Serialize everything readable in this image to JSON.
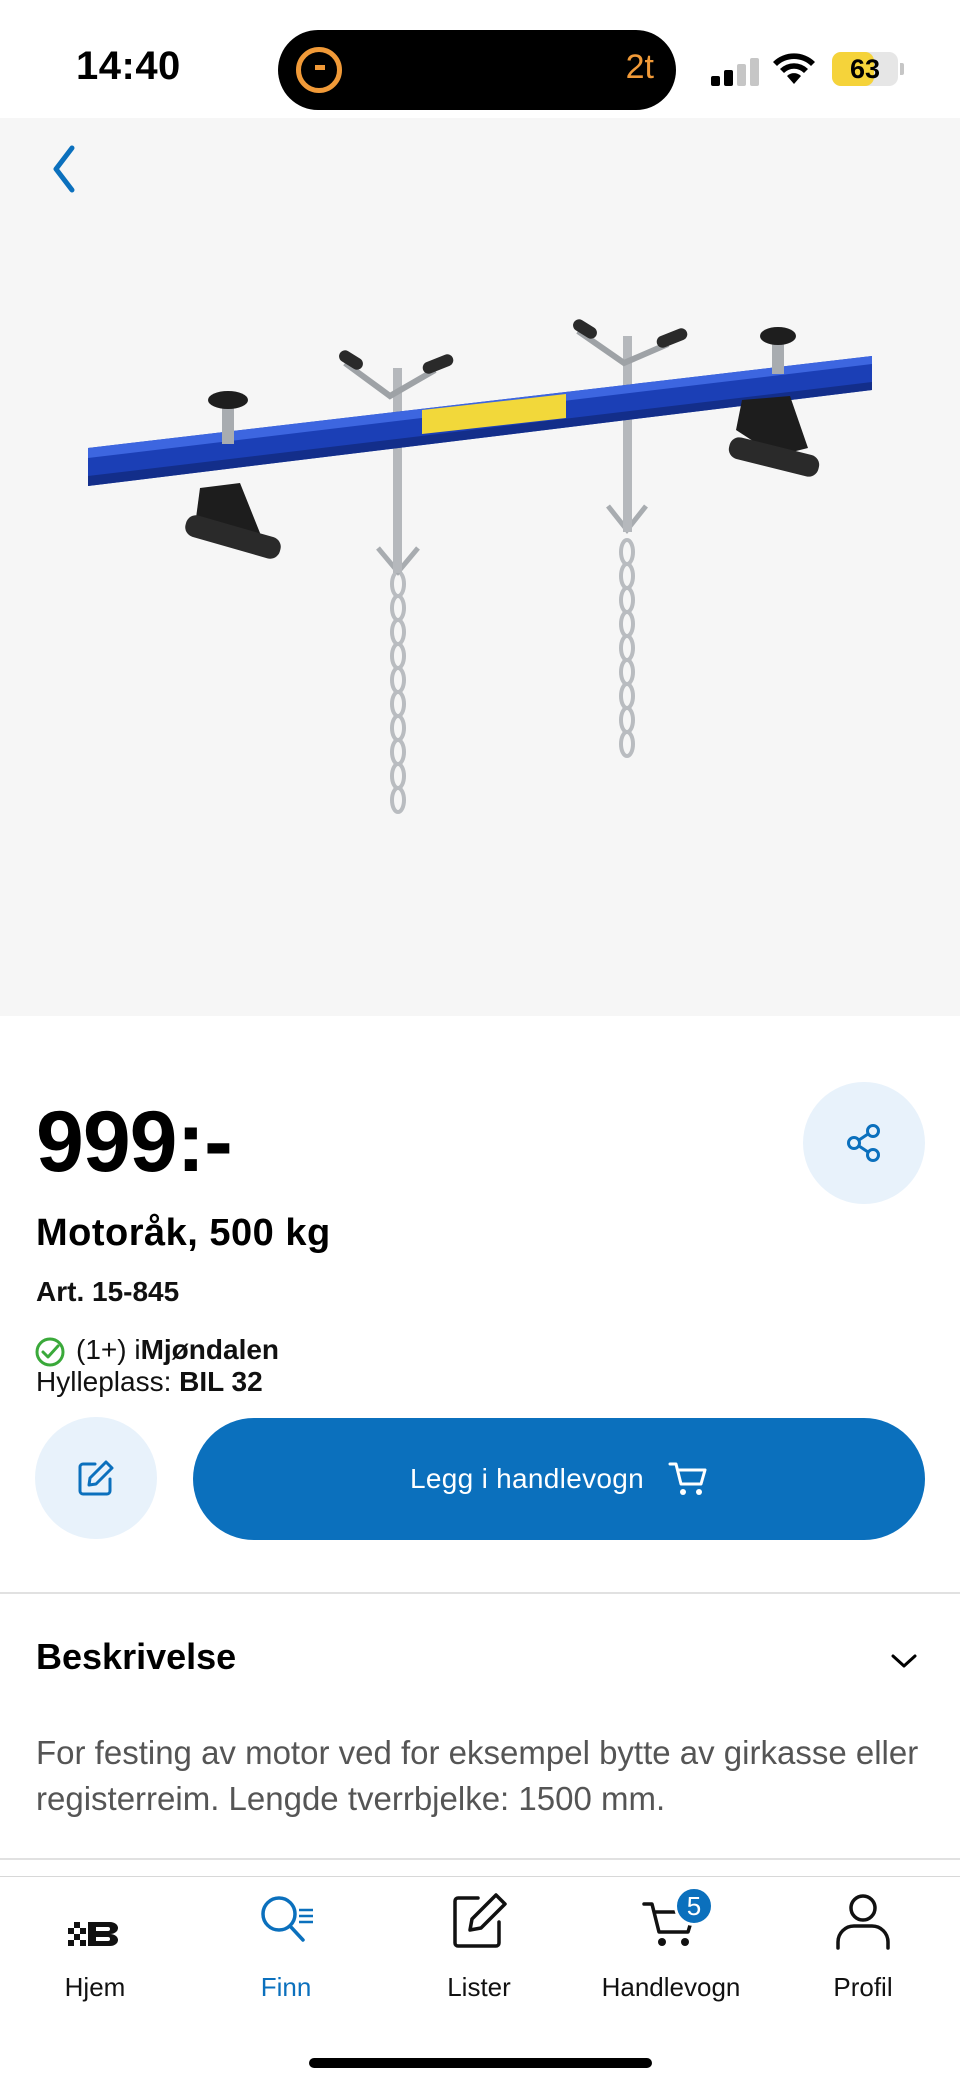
{
  "status_bar": {
    "time": "14:40",
    "activity_text": "2t",
    "battery_level": "63"
  },
  "product": {
    "price": "999:-",
    "name": "Motoråk, 500 kg",
    "article_number": "Art. 15-845",
    "stock_count": "(1+) i ",
    "stock_store": "Mjøndalen",
    "shelf_label": "Hylleplass: ",
    "shelf_value": "BIL 32",
    "add_to_cart_label": "Legg i handlevogn"
  },
  "description": {
    "title": "Beskrivelse",
    "text": "For festing av motor ved for eksempel bytte av girkasse eller registerreim. Lengde tverrbjelke: 1500 mm.",
    "expanded": true
  },
  "tabbar": {
    "items": [
      {
        "label": "Hjem",
        "icon": "brand-logo-icon",
        "active": false
      },
      {
        "label": "Finn",
        "icon": "search-list-icon",
        "active": true
      },
      {
        "label": "Lister",
        "icon": "edit-list-icon",
        "active": false
      },
      {
        "label": "Handlevogn",
        "icon": "cart-icon",
        "active": false
      },
      {
        "label": "Profil",
        "icon": "user-icon",
        "active": false
      }
    ],
    "cart_count": "5"
  },
  "colors": {
    "accent": "#0b70bd",
    "accent_light": "#e8f2fb",
    "stock_green": "#3aa93a",
    "timer_orange": "#f19a38",
    "battery_yellow": "#f5d33a"
  }
}
